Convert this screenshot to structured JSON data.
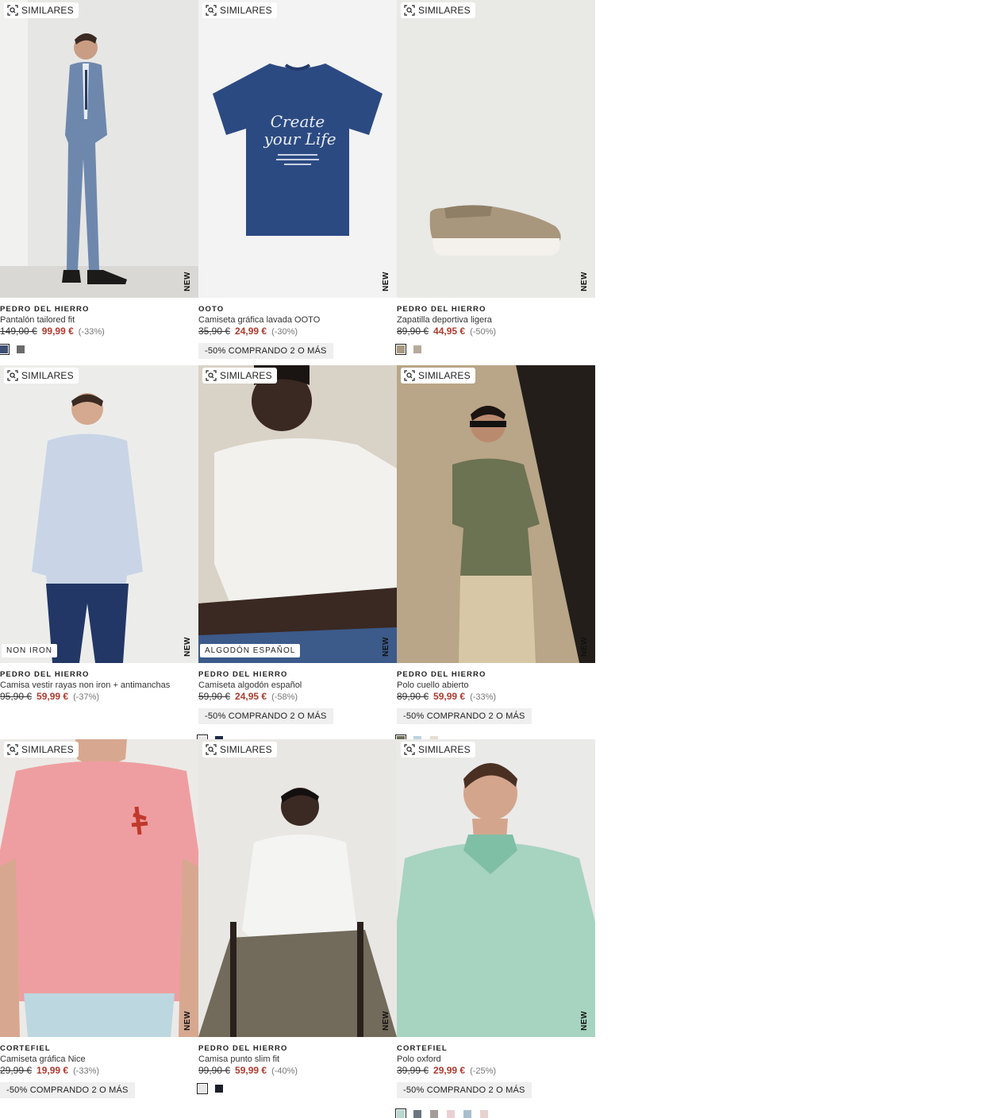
{
  "ui": {
    "similar_label": "SIMILARES",
    "new_label": "NEW"
  },
  "products": [
    {
      "brand": "PEDRO DEL HIERRO",
      "name": "Pantalón tailored fit",
      "old_price": "149,00 €",
      "price": "99,99 €",
      "discount": "(-33%)",
      "promo": "",
      "tag": "",
      "swatches": [
        "#3c4f73",
        "#6b6b6b"
      ]
    },
    {
      "brand": "OOTO",
      "name": "Camiseta gráfica lavada OOTO",
      "old_price": "35,90 €",
      "price": "24,99 €",
      "discount": "(-30%)",
      "promo": "-50% COMPRANDO 2 O MÁS",
      "tag": "",
      "swatches": []
    },
    {
      "brand": "PEDRO DEL HIERRO",
      "name": "Zapatilla deportiva ligera",
      "old_price": "89,90 €",
      "price": "44,95 €",
      "discount": "(-50%)",
      "promo": "",
      "tag": "",
      "swatches": [
        "#a89a82",
        "#b5ab9b"
      ]
    },
    {
      "brand": "PEDRO DEL HIERRO",
      "name": "Camisa vestir rayas non iron + antimanchas",
      "old_price": "95,90 €",
      "price": "59,99 €",
      "discount": "(-37%)",
      "promo": "",
      "tag": "NON IRON",
      "swatches": []
    },
    {
      "brand": "PEDRO DEL HIERRO",
      "name": "Camiseta algodón español",
      "old_price": "59,90 €",
      "price": "24,95 €",
      "discount": "(-58%)",
      "promo": "-50% COMPRANDO 2 O MÁS",
      "tag": "ALGODÓN ESPAÑOL",
      "swatches": [
        "#e8e8e8",
        "#1f2a44"
      ]
    },
    {
      "brand": "PEDRO DEL HIERRO",
      "name": "Polo cuello abierto",
      "old_price": "89,90 €",
      "price": "59,99 €",
      "discount": "(-33%)",
      "promo": "-50% COMPRANDO 2 O MÁS",
      "tag": "",
      "swatches": [
        "#6b6f55",
        "#bcd3df",
        "#e7ddd3"
      ]
    },
    {
      "brand": "CORTEFIEL",
      "name": "Camiseta gráfica Nice",
      "old_price": "29,99 €",
      "price": "19,99 €",
      "discount": "(-33%)",
      "promo": "-50% COMPRANDO 2 O MÁS",
      "tag": "",
      "swatches": []
    },
    {
      "brand": "PEDRO DEL HIERRO",
      "name": "Camisa punto slim fit",
      "old_price": "99,90 €",
      "price": "59,99 €",
      "discount": "(-40%)",
      "promo": "",
      "tag": "",
      "swatches": [
        "#e8e8e8",
        "#1c1f2b"
      ]
    },
    {
      "brand": "CORTEFIEL",
      "name": "Polo oxford",
      "old_price": "39,99 €",
      "price": "29,99 €",
      "discount": "(-25%)",
      "promo": "-50% COMPRANDO 2 O MÁS",
      "tag": "",
      "swatches": [
        "#b9d8d0",
        "#6c7680",
        "#a39c98",
        "#ead0d3",
        "#a9bfcd",
        "#e7d2cf"
      ]
    }
  ]
}
